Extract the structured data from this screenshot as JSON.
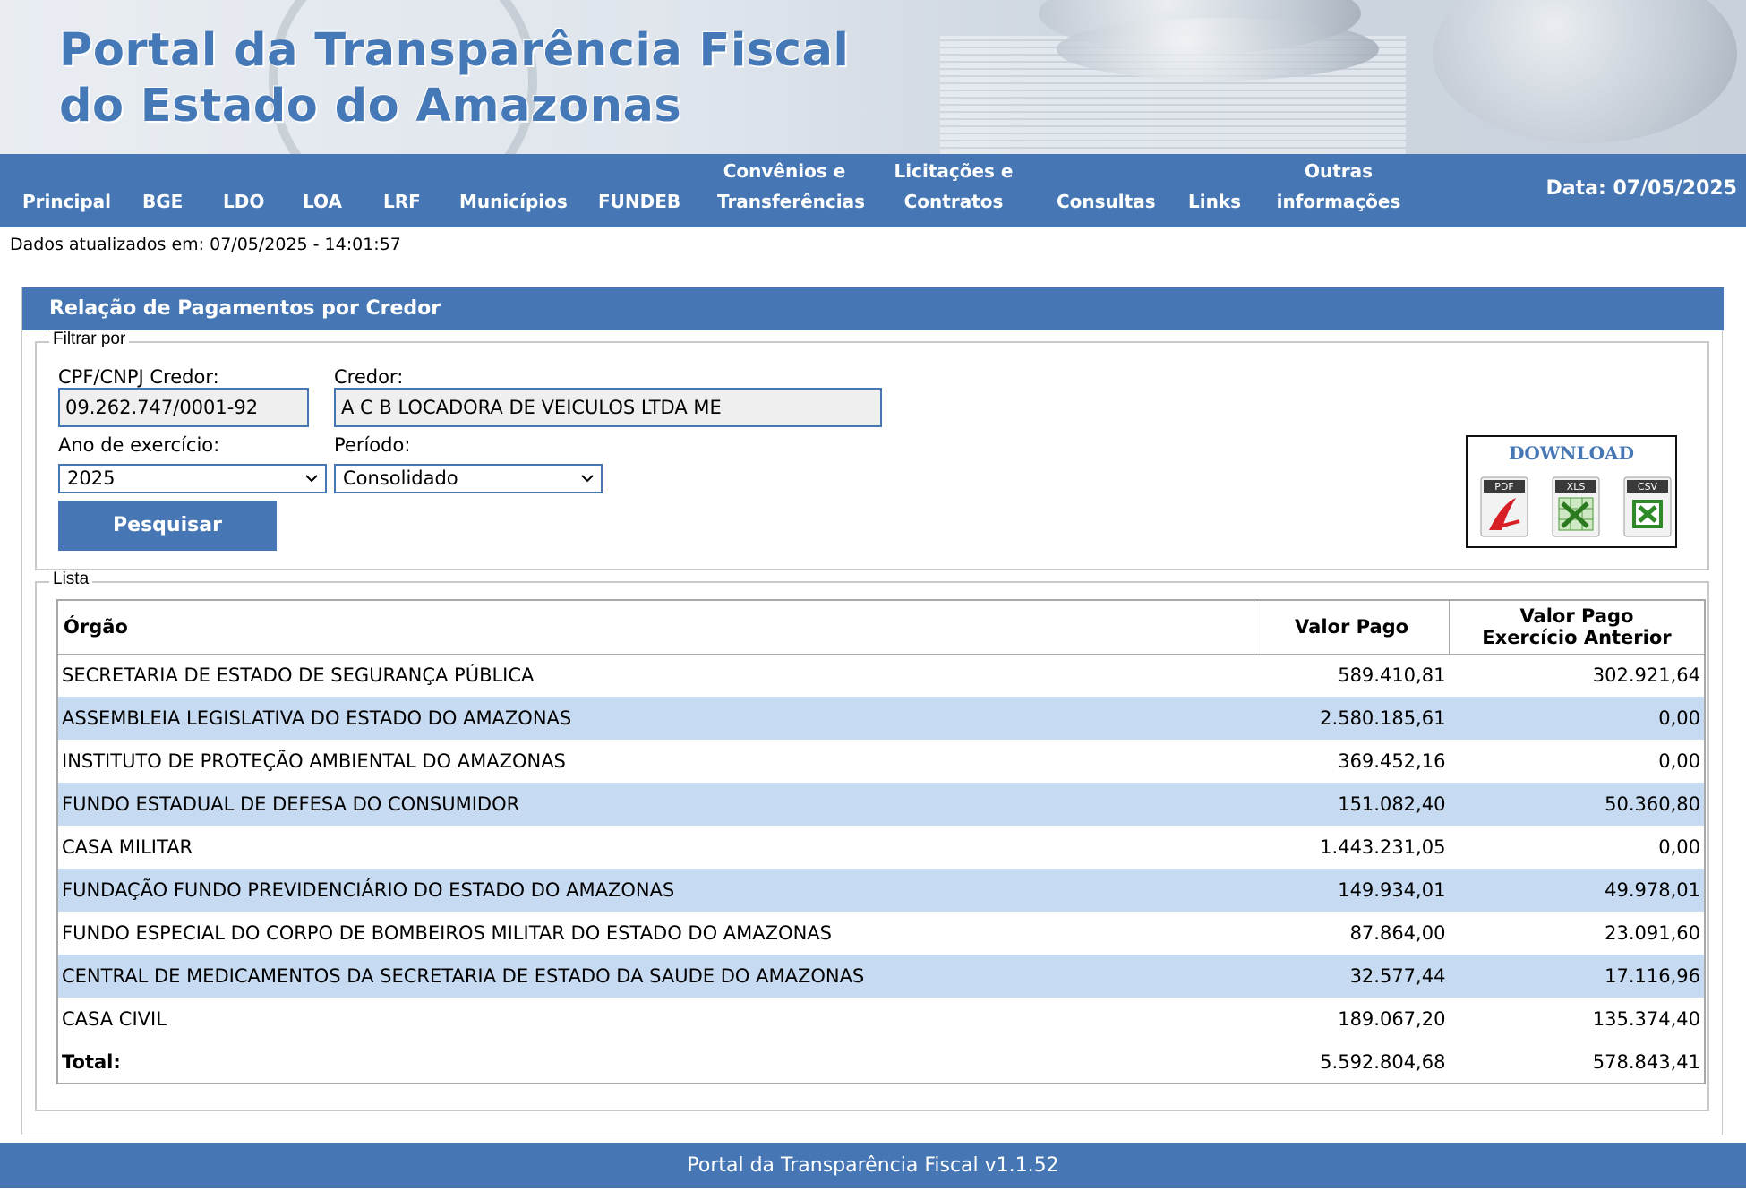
{
  "banner": {
    "line1": "Portal da Transparência Fiscal",
    "line2": "do Estado do Amazonas"
  },
  "nav": {
    "items": [
      {
        "label": "Principal"
      },
      {
        "label": "BGE"
      },
      {
        "label": "LDO"
      },
      {
        "label": "LOA"
      },
      {
        "label": "LRF"
      },
      {
        "label": "Municípios"
      },
      {
        "label": "FUNDEB"
      },
      {
        "line1": "Convênios e",
        "line2": "Transferências"
      },
      {
        "line1": "Licitações e",
        "line2": "Contratos"
      },
      {
        "label": "Consultas"
      },
      {
        "label": "Links"
      },
      {
        "line1": "Outras",
        "line2": "informações"
      }
    ],
    "date": "Data: 07/05/2025"
  },
  "updated": "Dados atualizados em: 07/05/2025 - 14:01:57",
  "panel": {
    "title": "Relação de Pagamentos por Credor"
  },
  "filter": {
    "legend": "Filtrar por",
    "cpf_label": "CPF/CNPJ Credor:",
    "cpf_value": "09.262.747/0001-92",
    "credor_label": "Credor:",
    "credor_value": "A C B LOCADORA DE VEICULOS LTDA  ME",
    "ano_label": "Ano de exercício:",
    "ano_value": "2025",
    "periodo_label": "Período:",
    "periodo_value": "Consolidado",
    "search_button": "Pesquisar"
  },
  "download": {
    "title": "DOWNLOAD",
    "pdf": "PDF",
    "xls": "XLS",
    "csv": "CSV"
  },
  "list": {
    "legend": "Lista",
    "headers": {
      "orgao": "Órgão",
      "valor_pago": "Valor Pago",
      "valor_anterior_line1": "Valor Pago",
      "valor_anterior_line2": "Exercício Anterior"
    },
    "rows": [
      {
        "orgao": "SECRETARIA DE ESTADO DE SEGURANÇA PÚBLICA",
        "valor": "589.410,81",
        "anterior": "302.921,64"
      },
      {
        "orgao": "ASSEMBLEIA LEGISLATIVA DO ESTADO DO AMAZONAS",
        "valor": "2.580.185,61",
        "anterior": "0,00"
      },
      {
        "orgao": "INSTITUTO DE PROTEÇÃO AMBIENTAL DO AMAZONAS",
        "valor": "369.452,16",
        "anterior": "0,00"
      },
      {
        "orgao": "FUNDO ESTADUAL DE DEFESA DO CONSUMIDOR",
        "valor": "151.082,40",
        "anterior": "50.360,80"
      },
      {
        "orgao": "CASA MILITAR",
        "valor": "1.443.231,05",
        "anterior": "0,00"
      },
      {
        "orgao": "FUNDAÇÃO FUNDO PREVIDENCIÁRIO DO ESTADO DO AMAZONAS",
        "valor": "149.934,01",
        "anterior": "49.978,01"
      },
      {
        "orgao": "FUNDO ESPECIAL DO CORPO DE BOMBEIROS MILITAR DO ESTADO DO AMAZONAS",
        "valor": "87.864,00",
        "anterior": "23.091,60"
      },
      {
        "orgao": "CENTRAL DE MEDICAMENTOS DA SECRETARIA DE ESTADO DA SAUDE DO AMAZONAS",
        "valor": "32.577,44",
        "anterior": "17.116,96"
      },
      {
        "orgao": "CASA CIVIL",
        "valor": "189.067,20",
        "anterior": "135.374,40"
      }
    ],
    "total": {
      "label": "Total:",
      "valor": "5.592.804,68",
      "anterior": "578.843,41"
    }
  },
  "footer": "Portal da Transparência Fiscal v1.1.52",
  "colors": {
    "primary": "#4677b4",
    "row_alt": "#c6daf1"
  }
}
